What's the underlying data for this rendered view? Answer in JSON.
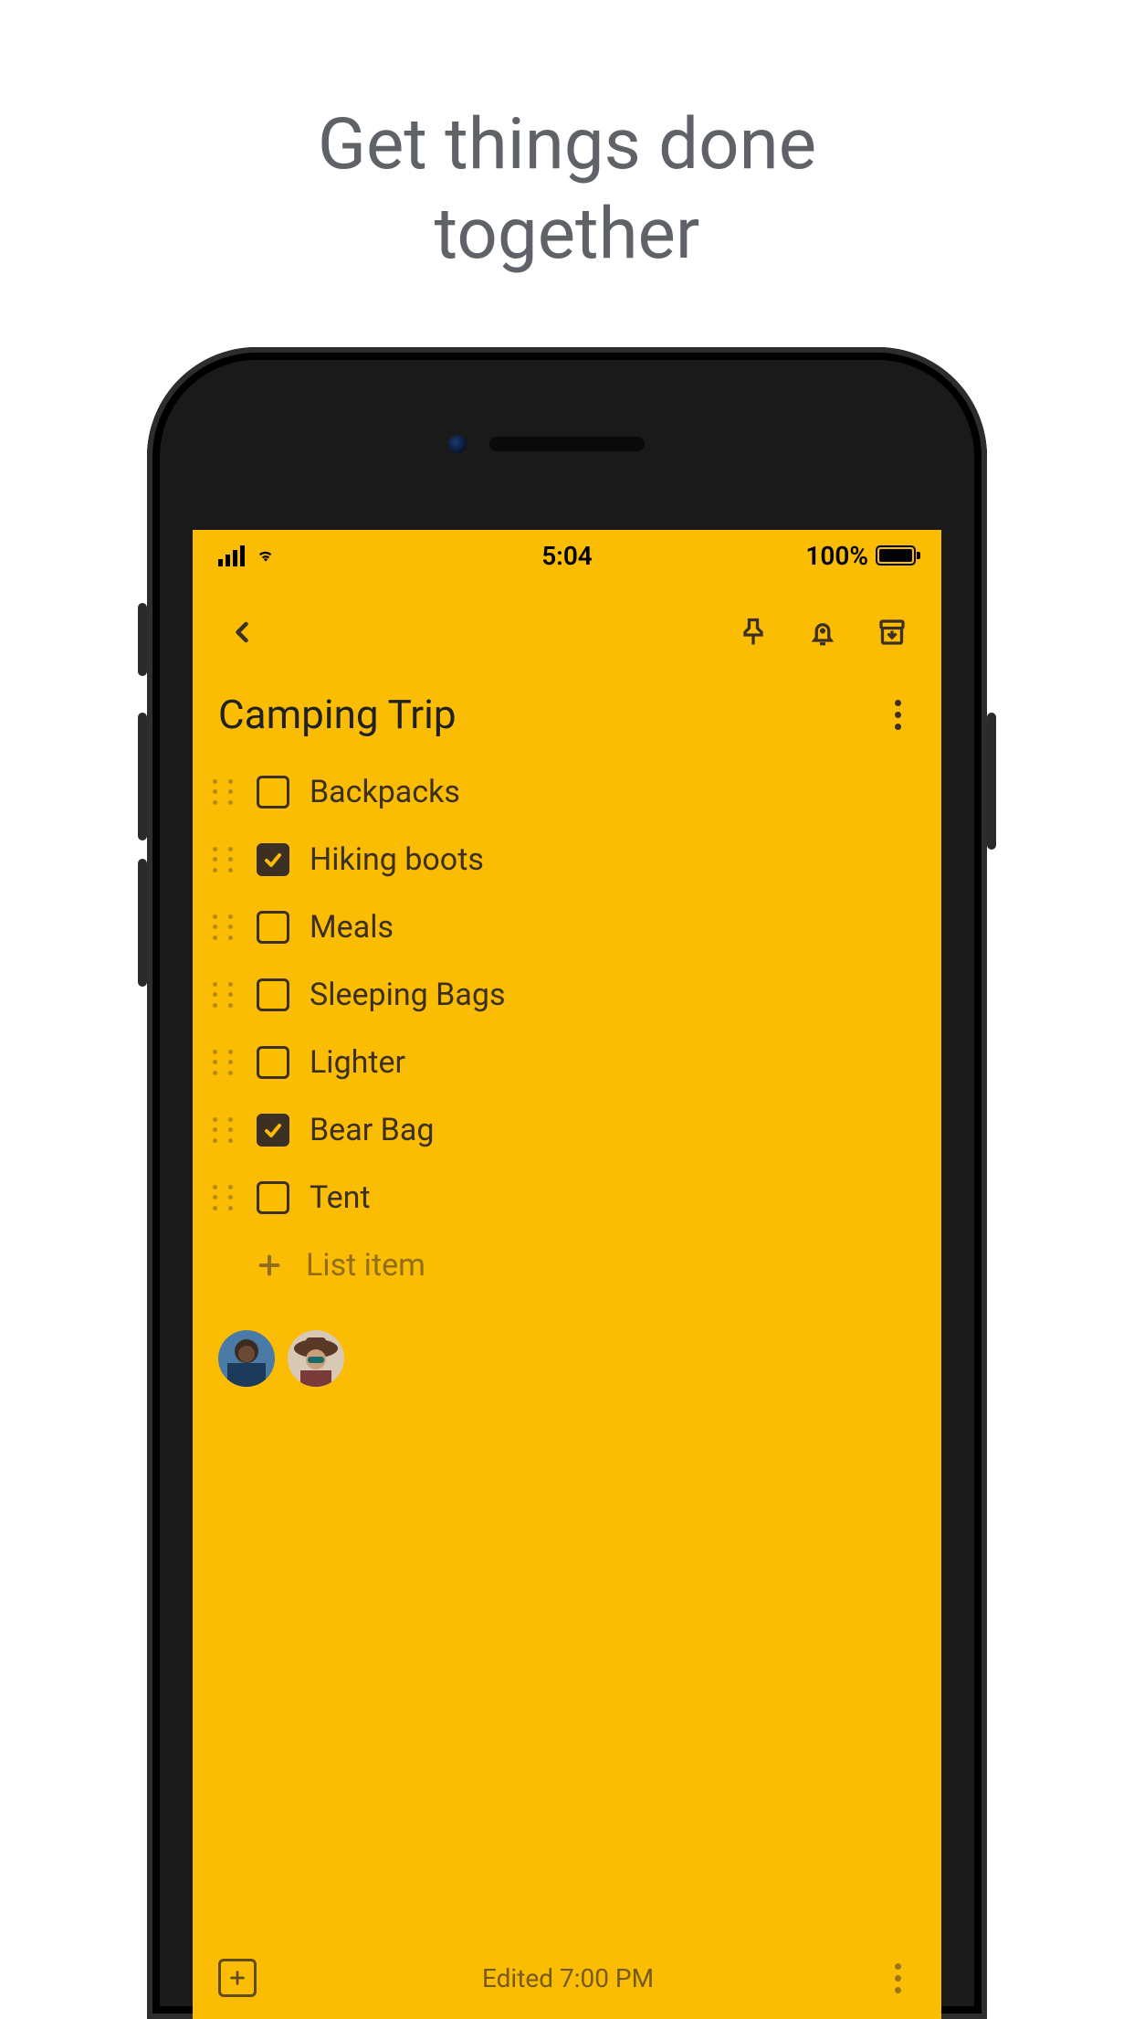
{
  "marketing": {
    "headline_line1": "Get things done",
    "headline_line2": "together"
  },
  "status_bar": {
    "time": "5:04",
    "battery_pct": "100%"
  },
  "toolbar": {
    "icons": {
      "back": "chevron-left-icon",
      "pin": "pin-icon",
      "reminder": "bell-add-icon",
      "archive": "archive-icon"
    }
  },
  "note": {
    "title": "Camping Trip",
    "items": [
      {
        "label": "Backpacks",
        "checked": false
      },
      {
        "label": "Hiking boots",
        "checked": true
      },
      {
        "label": "Meals",
        "checked": false
      },
      {
        "label": "Sleeping Bags",
        "checked": false
      },
      {
        "label": "Lighter",
        "checked": false
      },
      {
        "label": "Bear Bag",
        "checked": true
      },
      {
        "label": "Tent",
        "checked": false
      }
    ],
    "add_item_placeholder": "List item"
  },
  "collaborators": [
    {
      "name": "collaborator-1"
    },
    {
      "name": "collaborator-2"
    }
  ],
  "footer": {
    "edited_label": "Edited 7:00 PM"
  },
  "colors": {
    "note_bg": "#fbbc04",
    "text": "#3c3024"
  }
}
